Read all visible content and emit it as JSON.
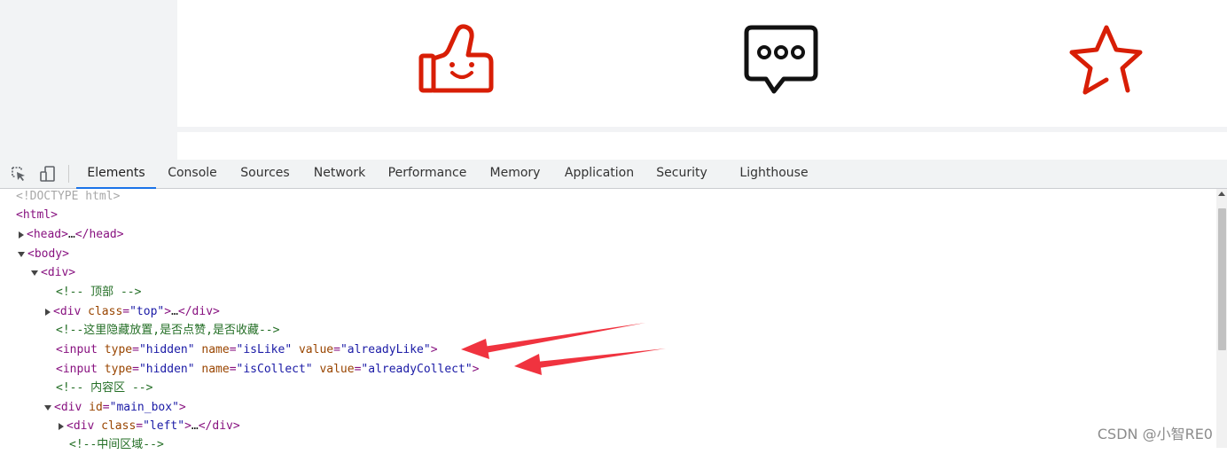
{
  "page": {
    "icons": [
      "thumbs-up-icon",
      "comment-icon",
      "star-icon"
    ],
    "colors": {
      "like": "#d81e06",
      "comment": "#111111",
      "star": "#d81e06"
    }
  },
  "devtools": {
    "tabs": [
      "Elements",
      "Console",
      "Sources",
      "Network",
      "Performance",
      "Memory",
      "Application",
      "Security",
      "Lighthouse"
    ],
    "active_tab": "Elements",
    "accent": "#1a73e8"
  },
  "code": {
    "doctype": "<!DOCTYPE html>",
    "html_open": "<html>",
    "head_open": "<head>",
    "ellipsis": "…",
    "head_close": "</head>",
    "body_open": "<body>",
    "div_open": "<div>",
    "comment_top": "<!-- 顶部 -->",
    "div_lt": "<div",
    "attr_class": "class",
    "val_top": "\"top\"",
    "close_gt": ">",
    "div_close": "</div>",
    "comment_hidden": "<!--这里隐藏放置,是否点赞,是否收藏-->",
    "input_lt": "<input",
    "attr_type": "type",
    "val_hidden": "\"hidden\"",
    "attr_name": "name",
    "val_islike": "\"isLike\"",
    "attr_value": "value",
    "val_alreadylike": "\"alreadyLike\"",
    "val_iscollect": "\"isCollect\"",
    "val_alreadycollect": "\"alreadyCollect\"",
    "comment_content": "<!-- 内容区 -->",
    "attr_id": "id",
    "val_mainbox": "\"main_box\"",
    "val_left": "\"left\"",
    "comment_middle": "<!--中间区域-->"
  },
  "watermark": "CSDN @小智RE0",
  "annotation_color": "#f0333f"
}
